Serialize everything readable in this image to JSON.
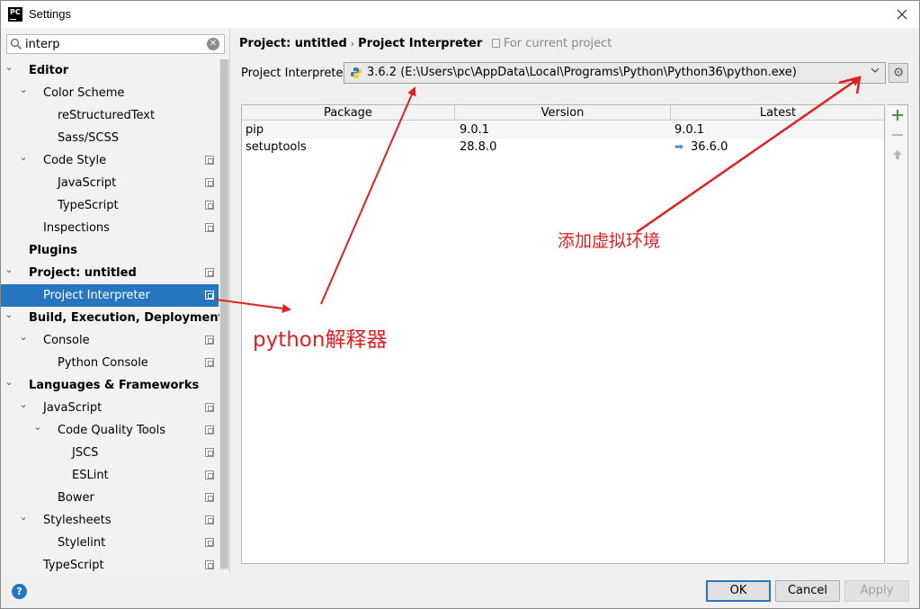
{
  "window": {
    "title": "Settings",
    "app_icon": "PC"
  },
  "sidebar": {
    "search_value": "interp",
    "items": [
      {
        "label": "Editor",
        "bold": true,
        "level": 0,
        "expanded": true,
        "copy": false
      },
      {
        "label": "Color Scheme",
        "bold": false,
        "level": 1,
        "expanded": true,
        "copy": false
      },
      {
        "label": "reStructuredText",
        "bold": false,
        "level": 2,
        "copy": false
      },
      {
        "label": "Sass/SCSS",
        "bold": false,
        "level": 2,
        "copy": false
      },
      {
        "label": "Code Style",
        "bold": false,
        "level": 1,
        "expanded": true,
        "copy": true
      },
      {
        "label": "JavaScript",
        "bold": false,
        "level": 2,
        "copy": true
      },
      {
        "label": "TypeScript",
        "bold": false,
        "level": 2,
        "copy": true
      },
      {
        "label": "Inspections",
        "bold": false,
        "level": 1,
        "copy": true
      },
      {
        "label": "Plugins",
        "bold": true,
        "level": 0,
        "copy": false
      },
      {
        "label": "Project: untitled",
        "bold": true,
        "level": 0,
        "expanded": true,
        "copy": true
      },
      {
        "label": "Project Interpreter",
        "bold": false,
        "level": 1,
        "copy": true,
        "selected": true
      },
      {
        "label": "Build, Execution, Deployment",
        "bold": true,
        "level": 0,
        "expanded": true,
        "copy": false
      },
      {
        "label": "Console",
        "bold": false,
        "level": 1,
        "expanded": true,
        "copy": true
      },
      {
        "label": "Python Console",
        "bold": false,
        "level": 2,
        "copy": true
      },
      {
        "label": "Languages & Frameworks",
        "bold": true,
        "level": 0,
        "expanded": true,
        "copy": false
      },
      {
        "label": "JavaScript",
        "bold": false,
        "level": 1,
        "expanded": true,
        "copy": true
      },
      {
        "label": "Code Quality Tools",
        "bold": false,
        "level": 2,
        "expanded": true,
        "copy": true
      },
      {
        "label": "JSCS",
        "bold": false,
        "level": 3,
        "copy": true
      },
      {
        "label": "ESLint",
        "bold": false,
        "level": 3,
        "copy": true
      },
      {
        "label": "Bower",
        "bold": false,
        "level": 2,
        "copy": true
      },
      {
        "label": "Stylesheets",
        "bold": false,
        "level": 1,
        "expanded": true,
        "copy": true
      },
      {
        "label": "Stylelint",
        "bold": false,
        "level": 2,
        "copy": true
      },
      {
        "label": "TypeScript",
        "bold": false,
        "level": 1,
        "copy": true
      }
    ]
  },
  "header": {
    "breadcrumb_parent": "Project: untitled",
    "breadcrumb_separator": "›",
    "breadcrumb_current": "Project Interpreter",
    "hint": "For current project"
  },
  "interpreter": {
    "label": "Project Interpreter:",
    "value": "3.6.2 (E:\\Users\\pc\\AppData\\Local\\Programs\\Python\\Python36\\python.exe)"
  },
  "packages": {
    "columns": [
      "Package",
      "Version",
      "Latest"
    ],
    "rows": [
      {
        "package": "pip",
        "version": "9.0.1",
        "latest": "9.0.1",
        "upgrade": false
      },
      {
        "package": "setuptools",
        "version": "28.8.0",
        "latest": "36.6.0",
        "upgrade": true
      }
    ]
  },
  "buttons": {
    "ok": "OK",
    "cancel": "Cancel",
    "apply": "Apply"
  },
  "annotations": {
    "python_interpreter": "python解释器",
    "add_virtualenv": "添加虚拟环境",
    "color": "#e02020"
  }
}
